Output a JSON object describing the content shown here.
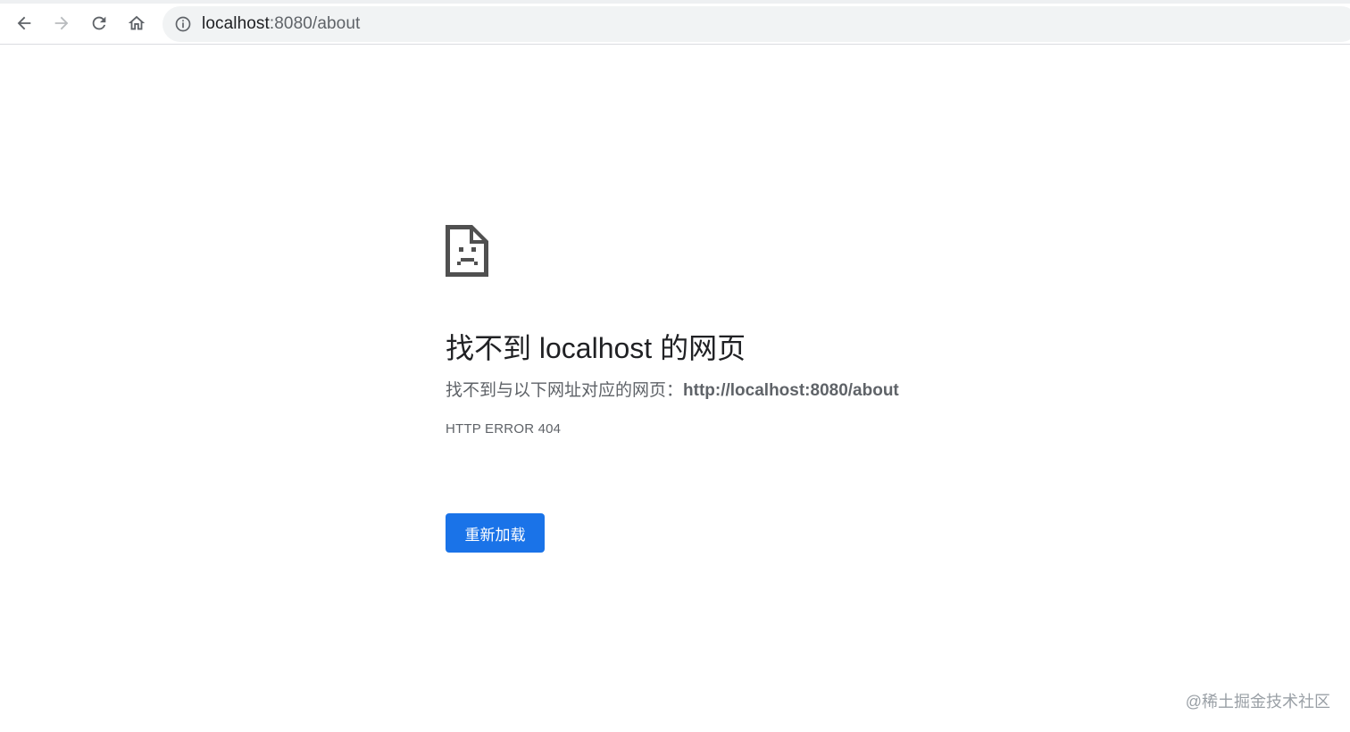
{
  "browser": {
    "url_host": "localhost",
    "url_path": ":8080/about"
  },
  "error_page": {
    "title": "找不到 localhost 的网页",
    "desc_prefix": "找不到与以下网址对应的网页：",
    "desc_url": "http://localhost:8080/about",
    "error_code": "HTTP ERROR 404",
    "reload_label": "重新加载"
  },
  "watermark": "@稀土掘金技术社区",
  "icons": {
    "back": "arrow-left-icon",
    "forward": "arrow-right-icon",
    "reload": "reload-icon",
    "home": "home-icon",
    "info": "info-icon",
    "page": "sad-page-icon"
  },
  "colors": {
    "accent": "#1a73e8",
    "text_primary": "#202124",
    "text_secondary": "#5f6368",
    "omnibox_bg": "#f1f3f4"
  }
}
